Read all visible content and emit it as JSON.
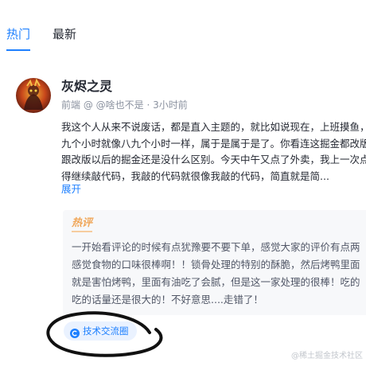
{
  "tabs": [
    {
      "label": "热门",
      "active": true
    },
    {
      "label": "最新",
      "active": false
    }
  ],
  "post": {
    "author": "灰烬之灵",
    "device": "前端",
    "mention": "@ @啥也不是",
    "separator": "·",
    "time": "3小时前",
    "content_lines": [
      "我这个人从来不说废话，都是直入主题的，就比如说现在，上班摸鱼，",
      "九个小时就像八九个小时一样，属于是属于是了。你看连这掘金都改版了",
      "跟改版以后的掘金还是没什么区别。今天中午又点了外卖，我上一次点",
      "得继续敲代码，我敲的代码就很像我敲的代码，简直就是简..."
    ],
    "expand_label": "展开"
  },
  "hot_comment": {
    "badge": "热评",
    "lines": [
      "一开始看评论的时候有点犹豫要不要下单，感觉大家的评价有点两",
      "感觉食物的口味很棒啊！！锁骨处理的特别的酥脆，然后烤鸭里面",
      "就是害怕烤鸭，里面有油吃了会腻，但是这一家处理的很棒！吃的",
      "吃的话量还是很大的！不好意思....走错了！"
    ]
  },
  "circle_tag": {
    "label": "技术交流圈",
    "icon": "circle-icon"
  },
  "watermark": "@稀土掘金技术社区",
  "colors": {
    "accent": "#1e80ff",
    "hot_badge": "#f0a75a",
    "tag_bg": "#eaf2ff"
  }
}
